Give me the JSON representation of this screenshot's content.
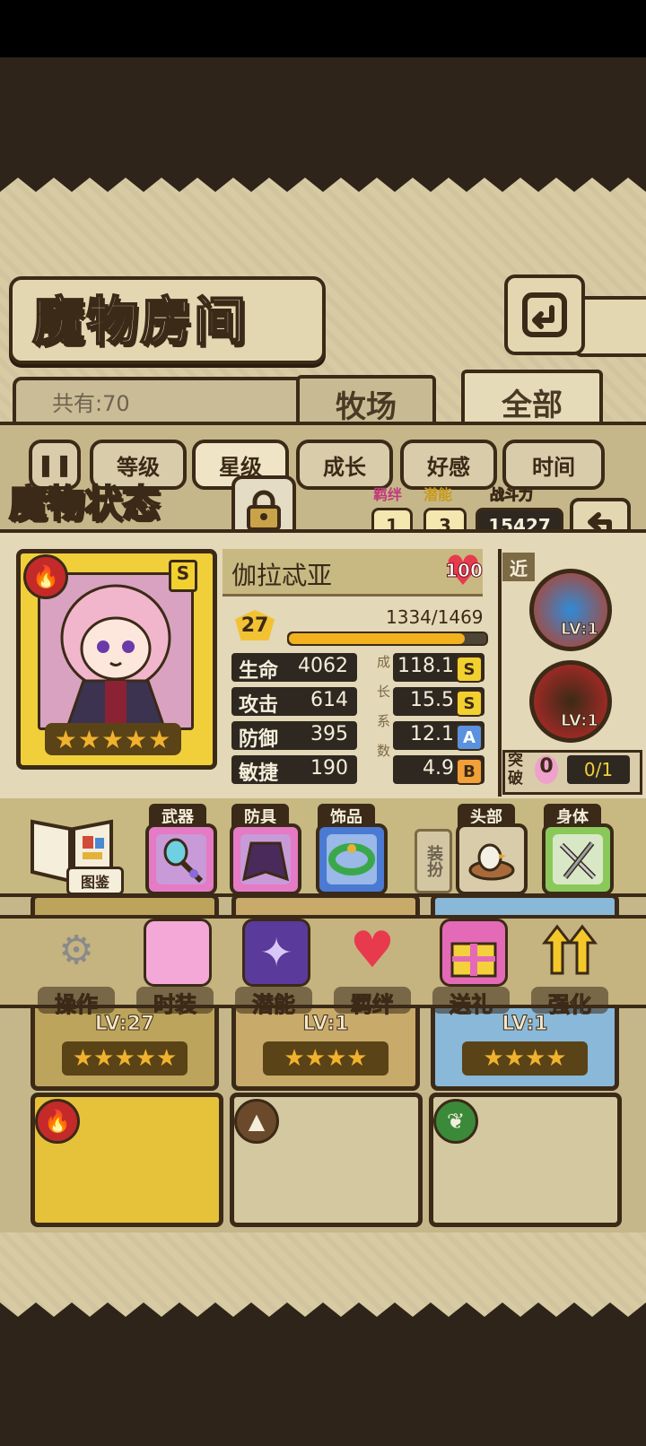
{
  "screen": {
    "title": "魔物房间",
    "owned_count": "共有:70",
    "tabs": [
      {
        "label": "牧场"
      },
      {
        "label": "全部"
      }
    ],
    "sort_buttons": [
      {
        "label": "等级"
      },
      {
        "label": "星级"
      },
      {
        "label": "成长"
      },
      {
        "label": "好感"
      },
      {
        "label": "时间"
      }
    ]
  },
  "status": {
    "title": "魔物状态",
    "bond_label": "羁绊",
    "bond_value": "1",
    "potential_label": "潜能",
    "potential_value": "3",
    "power_label": "战斗力",
    "power_value": "15427",
    "name": "伽拉忒亚",
    "affection": "100",
    "level": "27",
    "exp_text": "1334/1469",
    "exp_fraction": 0.908,
    "rarity": "S",
    "stars": 5,
    "stats": [
      {
        "label": "生命",
        "value": "4062",
        "growth": "118.1",
        "grade": "S"
      },
      {
        "label": "攻击",
        "value": "614",
        "growth": "15.5",
        "grade": "S"
      },
      {
        "label": "防御",
        "value": "395",
        "growth": "12.1",
        "grade": "A"
      },
      {
        "label": "敏捷",
        "value": "190",
        "growth": "4.9",
        "grade": "B"
      }
    ],
    "growth_vertical": "成长系数",
    "range": "近",
    "skills": [
      {
        "level": "LV:1"
      },
      {
        "level": "LV:1"
      }
    ],
    "breakthrough_label": "突破",
    "breakthrough_value": "0",
    "breakthrough_progress": "0/1"
  },
  "equipment": {
    "codex_label": "图鉴",
    "slots": [
      {
        "label": "武器",
        "icon": "staff-icon"
      },
      {
        "label": "防具",
        "icon": "cloak-icon"
      },
      {
        "label": "饰品",
        "icon": "bracelet-icon"
      },
      {
        "label": "头部",
        "icon": "egg-nest-icon"
      },
      {
        "label": "身体",
        "icon": "swords-icon"
      }
    ],
    "dress_label": "装扮"
  },
  "actions": [
    {
      "label": "操作",
      "icon": "gear-icon"
    },
    {
      "label": "时装",
      "icon": "outfit-icon"
    },
    {
      "label": "潜能",
      "icon": "demon-icon"
    },
    {
      "label": "羁绊",
      "icon": "hearts-icon"
    },
    {
      "label": "送礼",
      "icon": "gift-icon"
    },
    {
      "label": "强化",
      "icon": "upgrade-arrows-icon"
    }
  ],
  "grid_cards": [
    {
      "level": "LV:27"
    },
    {
      "level": "LV:1"
    },
    {
      "level": "LV:1"
    }
  ],
  "colors": {
    "outline": "#3b2a17",
    "paper": "#d8cba4",
    "gold": "#f0cf3b",
    "heart": "#e83a4d",
    "exp": "#f2b21e"
  }
}
